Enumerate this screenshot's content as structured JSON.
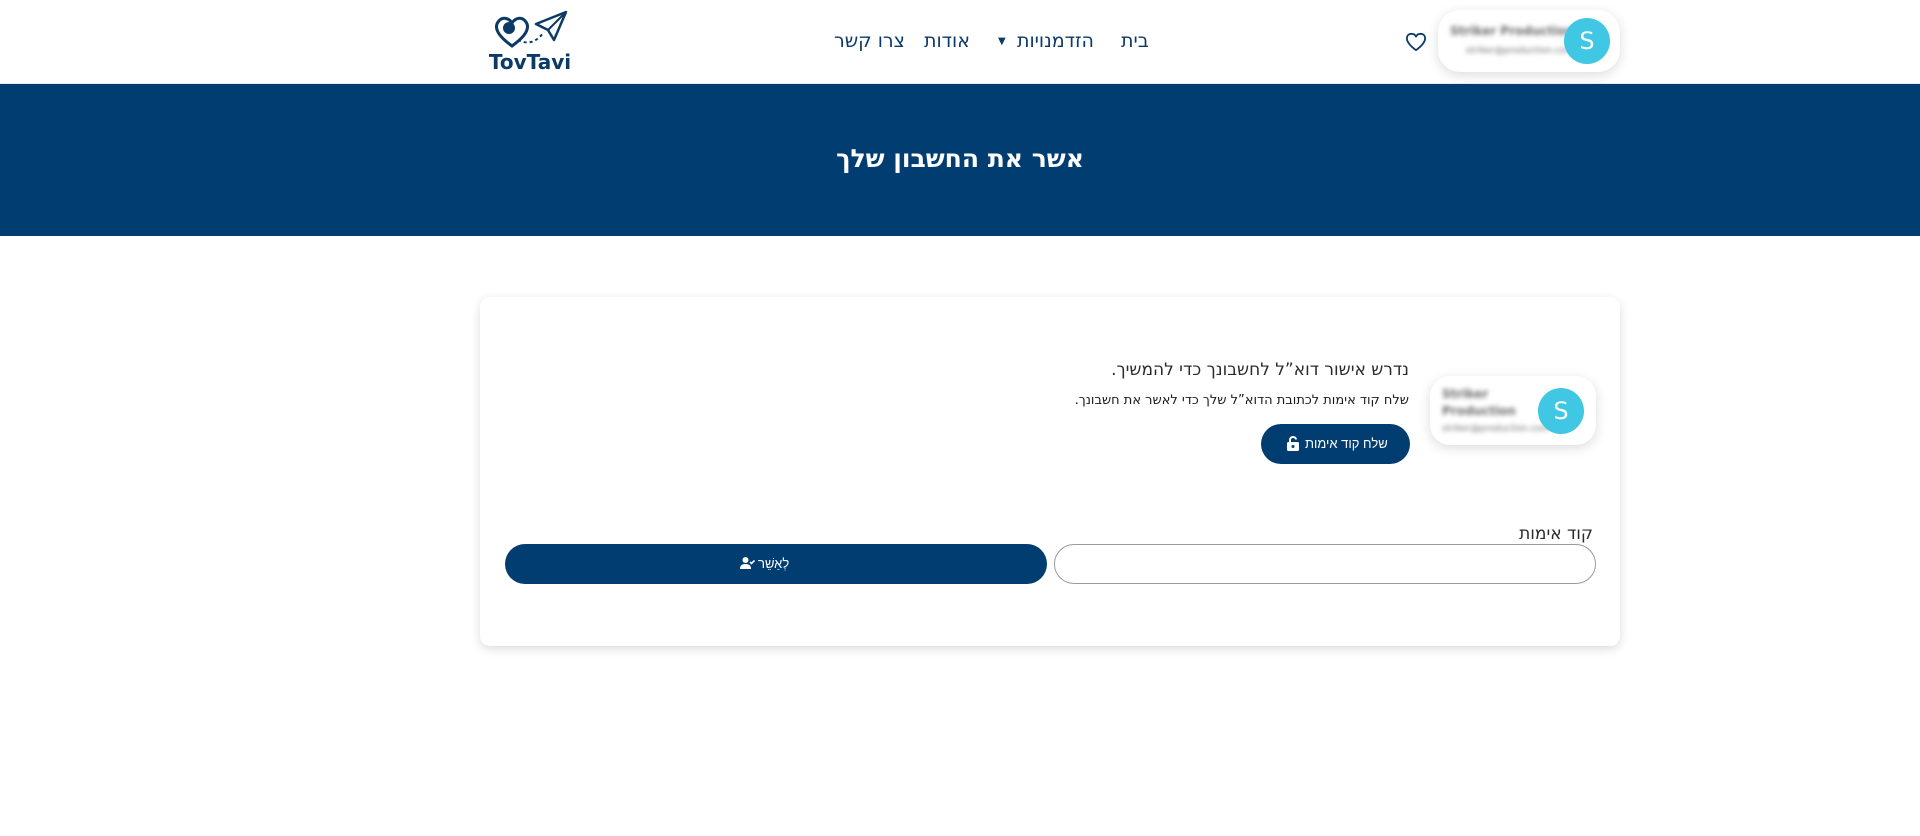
{
  "header": {
    "logo_text": "TovTavi",
    "nav": [
      {
        "label": "בית"
      },
      {
        "label": "הזדמנויות"
      },
      {
        "label": "אודות"
      },
      {
        "label": "צרו קשר"
      }
    ],
    "user": {
      "initial": "S",
      "name": "Striker Production",
      "email": "striker@production.com"
    }
  },
  "banner": {
    "title": "אשר את החשבון שלך"
  },
  "card": {
    "user": {
      "initial": "S",
      "name": "Striker Production",
      "email": "striker@production.com"
    },
    "requirement_text": "נדרש אישור דוא”ל לחשבונך כדי להמשיך.",
    "instruction_text": "שלח קוד אימות לכתובת הדוא”ל שלך כדי לאשר את חשבונך.",
    "send_code_label": "שלח קוד אימות",
    "code_label": "קוד אימות",
    "code_value": "",
    "verify_label": "לְאַשֵׁר"
  },
  "colors": {
    "primary": "#013d70",
    "avatar": "#3fc7e3"
  }
}
